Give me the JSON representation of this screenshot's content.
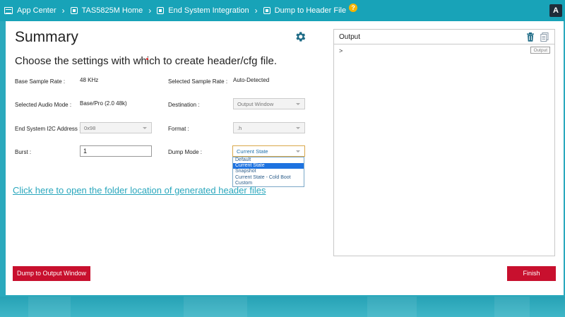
{
  "breadcrumb": {
    "items": [
      {
        "label": "App Center",
        "icon": "app-center-icon"
      },
      {
        "label": "TAS5825M Home",
        "icon": "chip-icon"
      },
      {
        "label": "End System Integration",
        "icon": "chip-icon"
      },
      {
        "label": "Dump to Header File",
        "icon": "chip-icon"
      }
    ],
    "help_badge": "?"
  },
  "user": {
    "avatar": "A"
  },
  "summary": {
    "title": "Summary",
    "subtitle": "Choose the settings with which to create header/cfg file."
  },
  "fields": {
    "base_sample_rate": {
      "label": "Base Sample Rate :",
      "value": "48 KHz"
    },
    "selected_sample_rate": {
      "label": "Selected Sample Rate :",
      "value": "Auto-Detected"
    },
    "selected_audio_mode": {
      "label": "Selected Audio Mode :",
      "value": "Base/Pro (2.0 48k)"
    },
    "destination": {
      "label": "Destination :",
      "value": "Output Window"
    },
    "i2c_address": {
      "label": "End System I2C Address :",
      "value": "0x98"
    },
    "format": {
      "label": "Format :",
      "value": ".h"
    },
    "burst": {
      "label": "Burst :",
      "value": "1"
    },
    "dump_mode": {
      "label": "Dump Mode :",
      "value": "Current State"
    }
  },
  "dump_mode_options": [
    "Default",
    "Current State",
    "Snapshot",
    "Current State - Cold Boot",
    "Custom"
  ],
  "dump_mode_selected_index": 1,
  "link_text": "Click here to open the folder location of generated header files",
  "output": {
    "title": "Output",
    "prompt": ">",
    "tag": "Output"
  },
  "buttons": {
    "dump": "Dump to Output Window",
    "finish": "Finish"
  },
  "colors": {
    "accent": "#18a3b8",
    "button": "#c8102e",
    "link": "#2aa7bd",
    "gear": "#1e6b86"
  }
}
